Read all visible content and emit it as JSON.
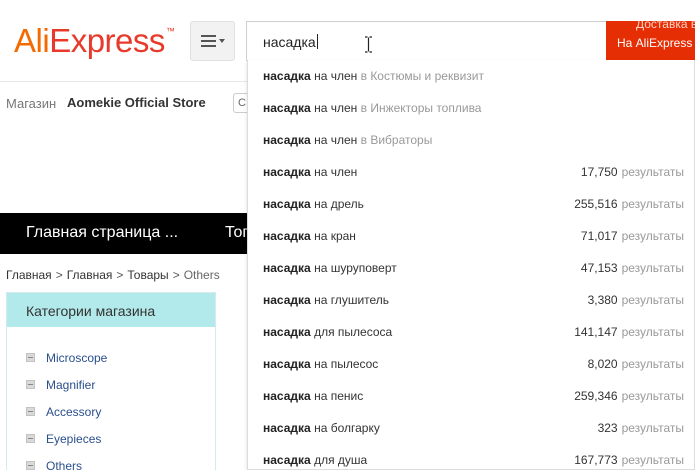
{
  "header": {
    "logo_part1": "Ali",
    "logo_part2": "Express",
    "logo_tm": "™",
    "search_value": "насадка",
    "search_button_line1": "Доставка в",
    "search_button_line2": "На AliExpress",
    "accent_color": "#e62e04"
  },
  "store_bar": {
    "label": "Магазин",
    "store_name": "Aomekie Official Store",
    "follow_text": "С"
  },
  "nav": {
    "home": "Главная страница ...",
    "second": "Топ"
  },
  "breadcrumb": {
    "items": [
      "Главная",
      "Главная",
      "Товары",
      "Others"
    ],
    "separator": ">"
  },
  "categories": {
    "title": "Категории магазина",
    "header_color": "#b2e9ea",
    "items": [
      "Microscope",
      "Magnifier",
      "Accessory",
      "Eyepieces",
      "Others"
    ]
  },
  "suggestions": [
    {
      "bold": "насадка",
      "rest": "на член",
      "category": "в Костюмы и реквизит",
      "count": "",
      "result_word": ""
    },
    {
      "bold": "насадка",
      "rest": "на член",
      "category": "в Инжекторы топлива",
      "count": "",
      "result_word": ""
    },
    {
      "bold": "насадка",
      "rest": "на член",
      "category": "в Вибраторы",
      "count": "",
      "result_word": ""
    },
    {
      "bold": "насадка",
      "rest": "на член",
      "category": "",
      "count": "17,750",
      "result_word": "результаты"
    },
    {
      "bold": "насадка",
      "rest": "на дрель",
      "category": "",
      "count": "255,516",
      "result_word": "результаты"
    },
    {
      "bold": "насадка",
      "rest": "на кран",
      "category": "",
      "count": "71,017",
      "result_word": "результаты"
    },
    {
      "bold": "насадка",
      "rest": "на шуруповерт",
      "category": "",
      "count": "47,153",
      "result_word": "результаты"
    },
    {
      "bold": "насадка",
      "rest": "на глушитель",
      "category": "",
      "count": "3,380",
      "result_word": "результаты"
    },
    {
      "bold": "насадка",
      "rest": "для пылесоса",
      "category": "",
      "count": "141,147",
      "result_word": "результаты"
    },
    {
      "bold": "насадка",
      "rest": "на пылесос",
      "category": "",
      "count": "8,020",
      "result_word": "результаты"
    },
    {
      "bold": "насадка",
      "rest": "на пенис",
      "category": "",
      "count": "259,346",
      "result_word": "результаты"
    },
    {
      "bold": "насадка",
      "rest": "на болгарку",
      "category": "",
      "count": "323",
      "result_word": "результаты"
    },
    {
      "bold": "насадка",
      "rest": "для душа",
      "category": "",
      "count": "167,773",
      "result_word": "результаты"
    }
  ]
}
